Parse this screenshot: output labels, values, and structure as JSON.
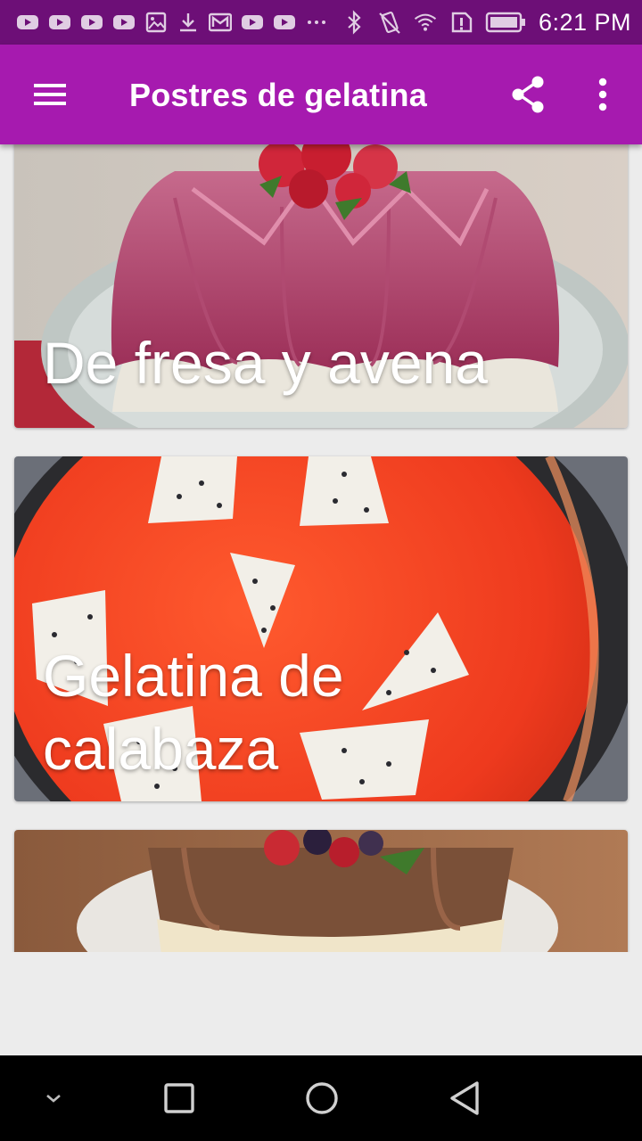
{
  "status_bar": {
    "time": "6:21 PM",
    "left_icons": [
      "youtube-icon",
      "youtube-icon",
      "youtube-icon",
      "youtube-icon",
      "image-icon",
      "download-icon",
      "gmail-icon",
      "youtube-icon",
      "youtube-icon",
      "more-notifications-icon"
    ],
    "right_icons": [
      "bluetooth-icon",
      "vibrate-icon",
      "wifi-icon",
      "sim-alert-icon",
      "battery-icon"
    ]
  },
  "app_bar": {
    "title": "Postres de gelatina",
    "menu_icon": "hamburger-menu-icon",
    "share_icon": "share-icon",
    "more_icon": "more-vert-icon",
    "color": "#a61aaf"
  },
  "cards": [
    {
      "label": "De fresa y avena"
    },
    {
      "label": "Gelatina de calabaza"
    },
    {
      "label": ""
    }
  ],
  "nav_bar": {
    "icons": [
      "hide-nav-icon",
      "recents-icon",
      "home-icon",
      "back-icon"
    ]
  },
  "colors": {
    "status_bar": "#6d0f77",
    "app_bar": "#a61aaf",
    "background": "#ececec"
  }
}
